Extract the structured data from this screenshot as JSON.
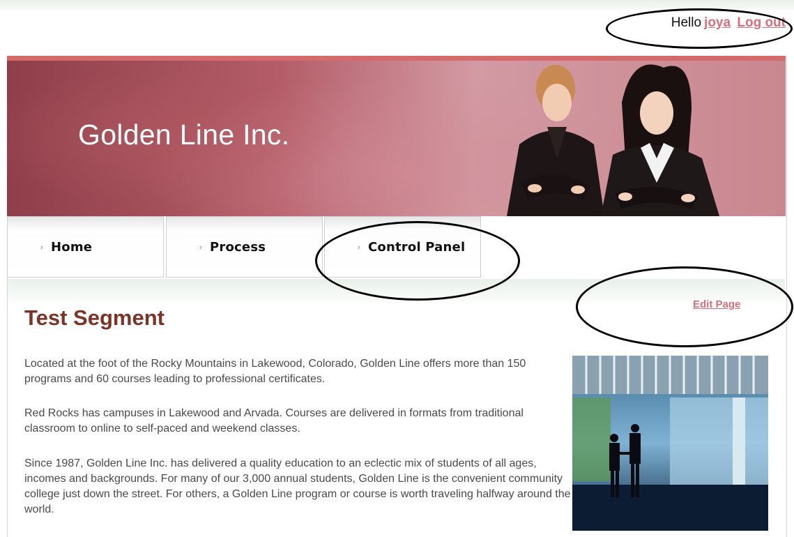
{
  "header": {
    "greeting": "Hello",
    "username": "joya",
    "logout": "Log out"
  },
  "banner": {
    "title": "Golden Line Inc."
  },
  "nav": {
    "tabs": [
      {
        "label": "Home"
      },
      {
        "label": "Process"
      },
      {
        "label": "Control Panel"
      }
    ]
  },
  "main": {
    "edit_link": "Edit Page",
    "title": "Test Segment",
    "paragraphs": [
      "Located at the foot of the Rocky Mountains in Lakewood, Colorado, Golden Line offers more than 150 programs and 60 courses leading to professional certificates.",
      "Red Rocks has campuses in Lakewood and Arvada. Courses are delivered in formats from traditional classroom to online to self-paced and weekend classes.",
      "Since 1987, Golden Line Inc. has delivered a quality education to an eclectic mix of students of all ages, incomes and backgrounds. For many of our 3,000 annual students, Golden Line is the convenient community college just down the street. For others, a Golden Line program or course is worth traveling halfway around the world."
    ]
  },
  "colors": {
    "accent": "#d66f7c",
    "banner": "#b45d68",
    "title": "#7c3328"
  }
}
